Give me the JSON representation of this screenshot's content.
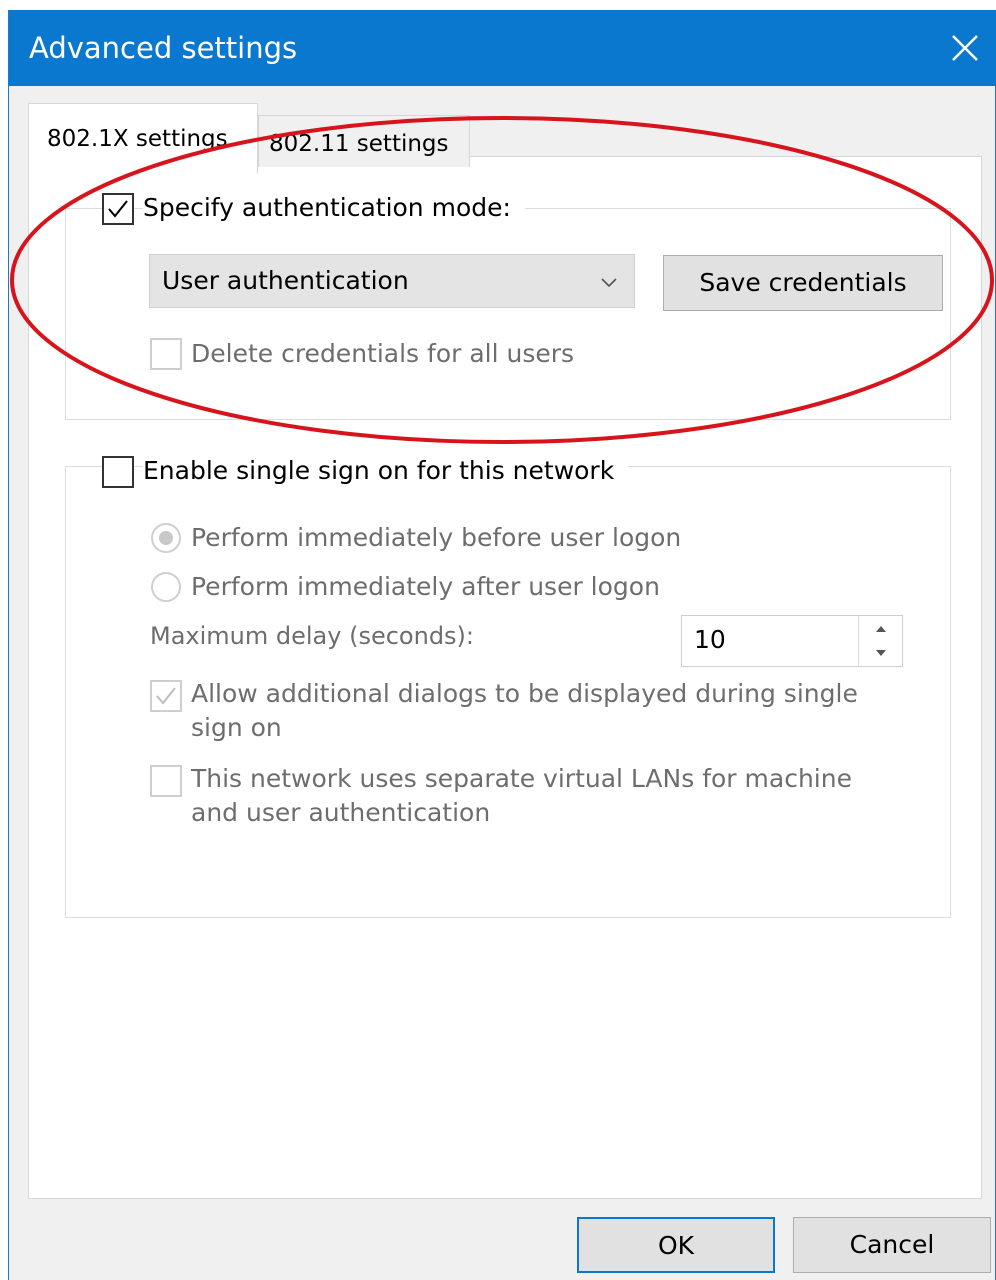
{
  "window": {
    "title": "Advanced settings",
    "accent_color": "#0b78d0"
  },
  "tabs": [
    {
      "label": "802.1X settings",
      "selected": true
    },
    {
      "label": "802.11 settings",
      "selected": false
    }
  ],
  "auth_group": {
    "specify_mode_label": "Specify authentication mode:",
    "specify_mode_checked": true,
    "mode_select_value": "User authentication",
    "save_credentials_label": "Save credentials",
    "delete_credentials_label": "Delete credentials for all users",
    "delete_credentials_checked": false
  },
  "sso_group": {
    "enable_label": "Enable single sign on for this network",
    "enable_checked": false,
    "option_before_label": "Perform immediately before user logon",
    "option_before_selected": true,
    "option_after_label": "Perform immediately after user logon",
    "option_after_selected": false,
    "max_delay_label": "Maximum delay (seconds):",
    "max_delay_value": "10",
    "allow_dialogs_line1": "Allow additional dialogs to be displayed during single",
    "allow_dialogs_line2": "sign on",
    "allow_dialogs_checked": true,
    "vlan_line1": "This network uses separate virtual LANs for machine",
    "vlan_line2": "and user authentication",
    "vlan_checked": false
  },
  "footer": {
    "ok_label": "OK",
    "cancel_label": "Cancel"
  },
  "annotation_color": "#d7141c"
}
